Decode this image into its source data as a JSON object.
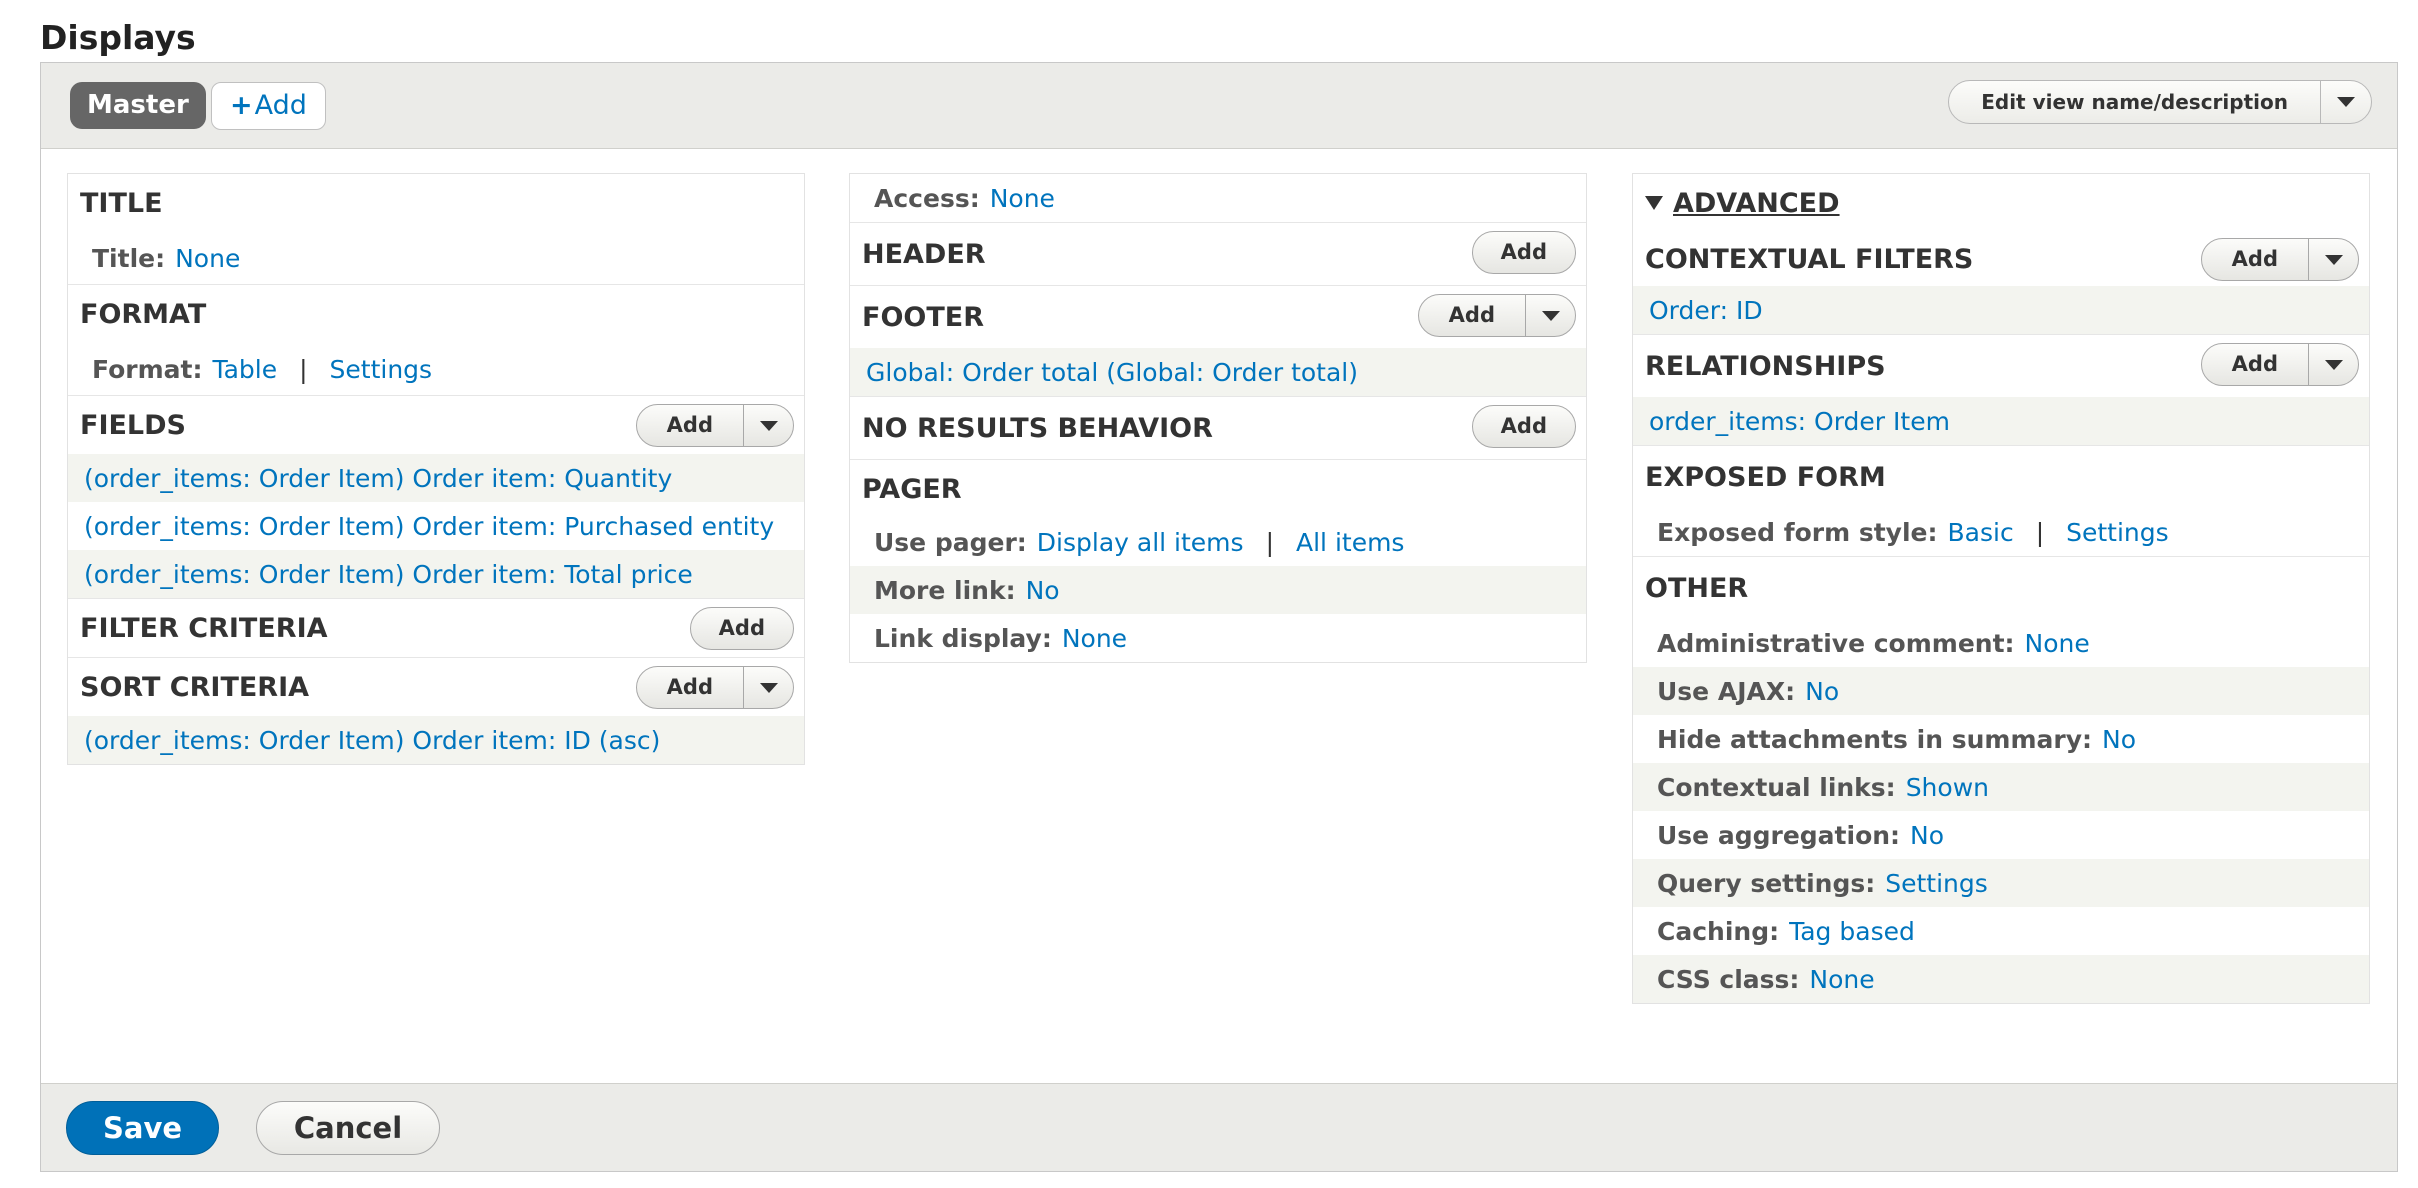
{
  "page": {
    "title": "Displays"
  },
  "tabs": {
    "master": "Master",
    "add": "Add",
    "add_plus": "+"
  },
  "edit": {
    "label": "Edit view name/description"
  },
  "col1": {
    "title_section": {
      "header": "TITLE",
      "key": "Title:",
      "value": "None"
    },
    "format_section": {
      "header": "FORMAT",
      "key": "Format:",
      "value": "Table",
      "sep": "|",
      "settings": "Settings"
    },
    "fields_section": {
      "header": "FIELDS",
      "add": "Add",
      "items": [
        "(order_items: Order Item) Order item: Quantity",
        "(order_items: Order Item) Order item: Purchased entity",
        "(order_items: Order Item) Order item: Total price"
      ]
    },
    "filter_section": {
      "header": "FILTER CRITERIA",
      "add": "Add"
    },
    "sort_section": {
      "header": "SORT CRITERIA",
      "add": "Add",
      "items": [
        "(order_items: Order Item) Order item: ID (asc)"
      ]
    }
  },
  "col2": {
    "access": {
      "key": "Access:",
      "value": "None"
    },
    "header_section": {
      "header": "HEADER",
      "add": "Add"
    },
    "footer_section": {
      "header": "FOOTER",
      "add": "Add",
      "items": [
        "Global: Order total (Global: Order total)"
      ]
    },
    "noresults_section": {
      "header": "NO RESULTS BEHAVIOR",
      "add": "Add"
    },
    "pager_section": {
      "header": "PAGER",
      "use_pager": {
        "key": "Use pager:",
        "value": "Display all items",
        "sep": "|",
        "value2": "All items"
      },
      "more_link": {
        "key": "More link:",
        "value": "No"
      },
      "link_display": {
        "key": "Link display:",
        "value": "None"
      }
    }
  },
  "col3": {
    "advanced": "ADVANCED",
    "contextual_section": {
      "header": "CONTEXTUAL FILTERS",
      "add": "Add",
      "items": [
        "Order: ID"
      ]
    },
    "relationships_section": {
      "header": "RELATIONSHIPS",
      "add": "Add",
      "items": [
        "order_items: Order Item"
      ]
    },
    "exposed_section": {
      "header": "EXPOSED FORM",
      "key": "Exposed form style:",
      "value": "Basic",
      "sep": "|",
      "settings": "Settings"
    },
    "other_section": {
      "header": "OTHER",
      "rows": [
        {
          "key": "Administrative comment:",
          "value": "None"
        },
        {
          "key": "Use AJAX:",
          "value": "No"
        },
        {
          "key": "Hide attachments in summary:",
          "value": "No"
        },
        {
          "key": "Contextual links:",
          "value": "Shown"
        },
        {
          "key": "Use aggregation:",
          "value": "No"
        },
        {
          "key": "Query settings:",
          "value": "Settings"
        },
        {
          "key": "Caching:",
          "value": "Tag based"
        },
        {
          "key": "CSS class:",
          "value": "None"
        }
      ]
    }
  },
  "footer_bar": {
    "save": "Save",
    "cancel": "Cancel"
  },
  "colors": {
    "link": "#0074bd",
    "save_button": "#0071b8",
    "bar_background": "#ebebe8",
    "row_shade": "#f3f4ef"
  }
}
